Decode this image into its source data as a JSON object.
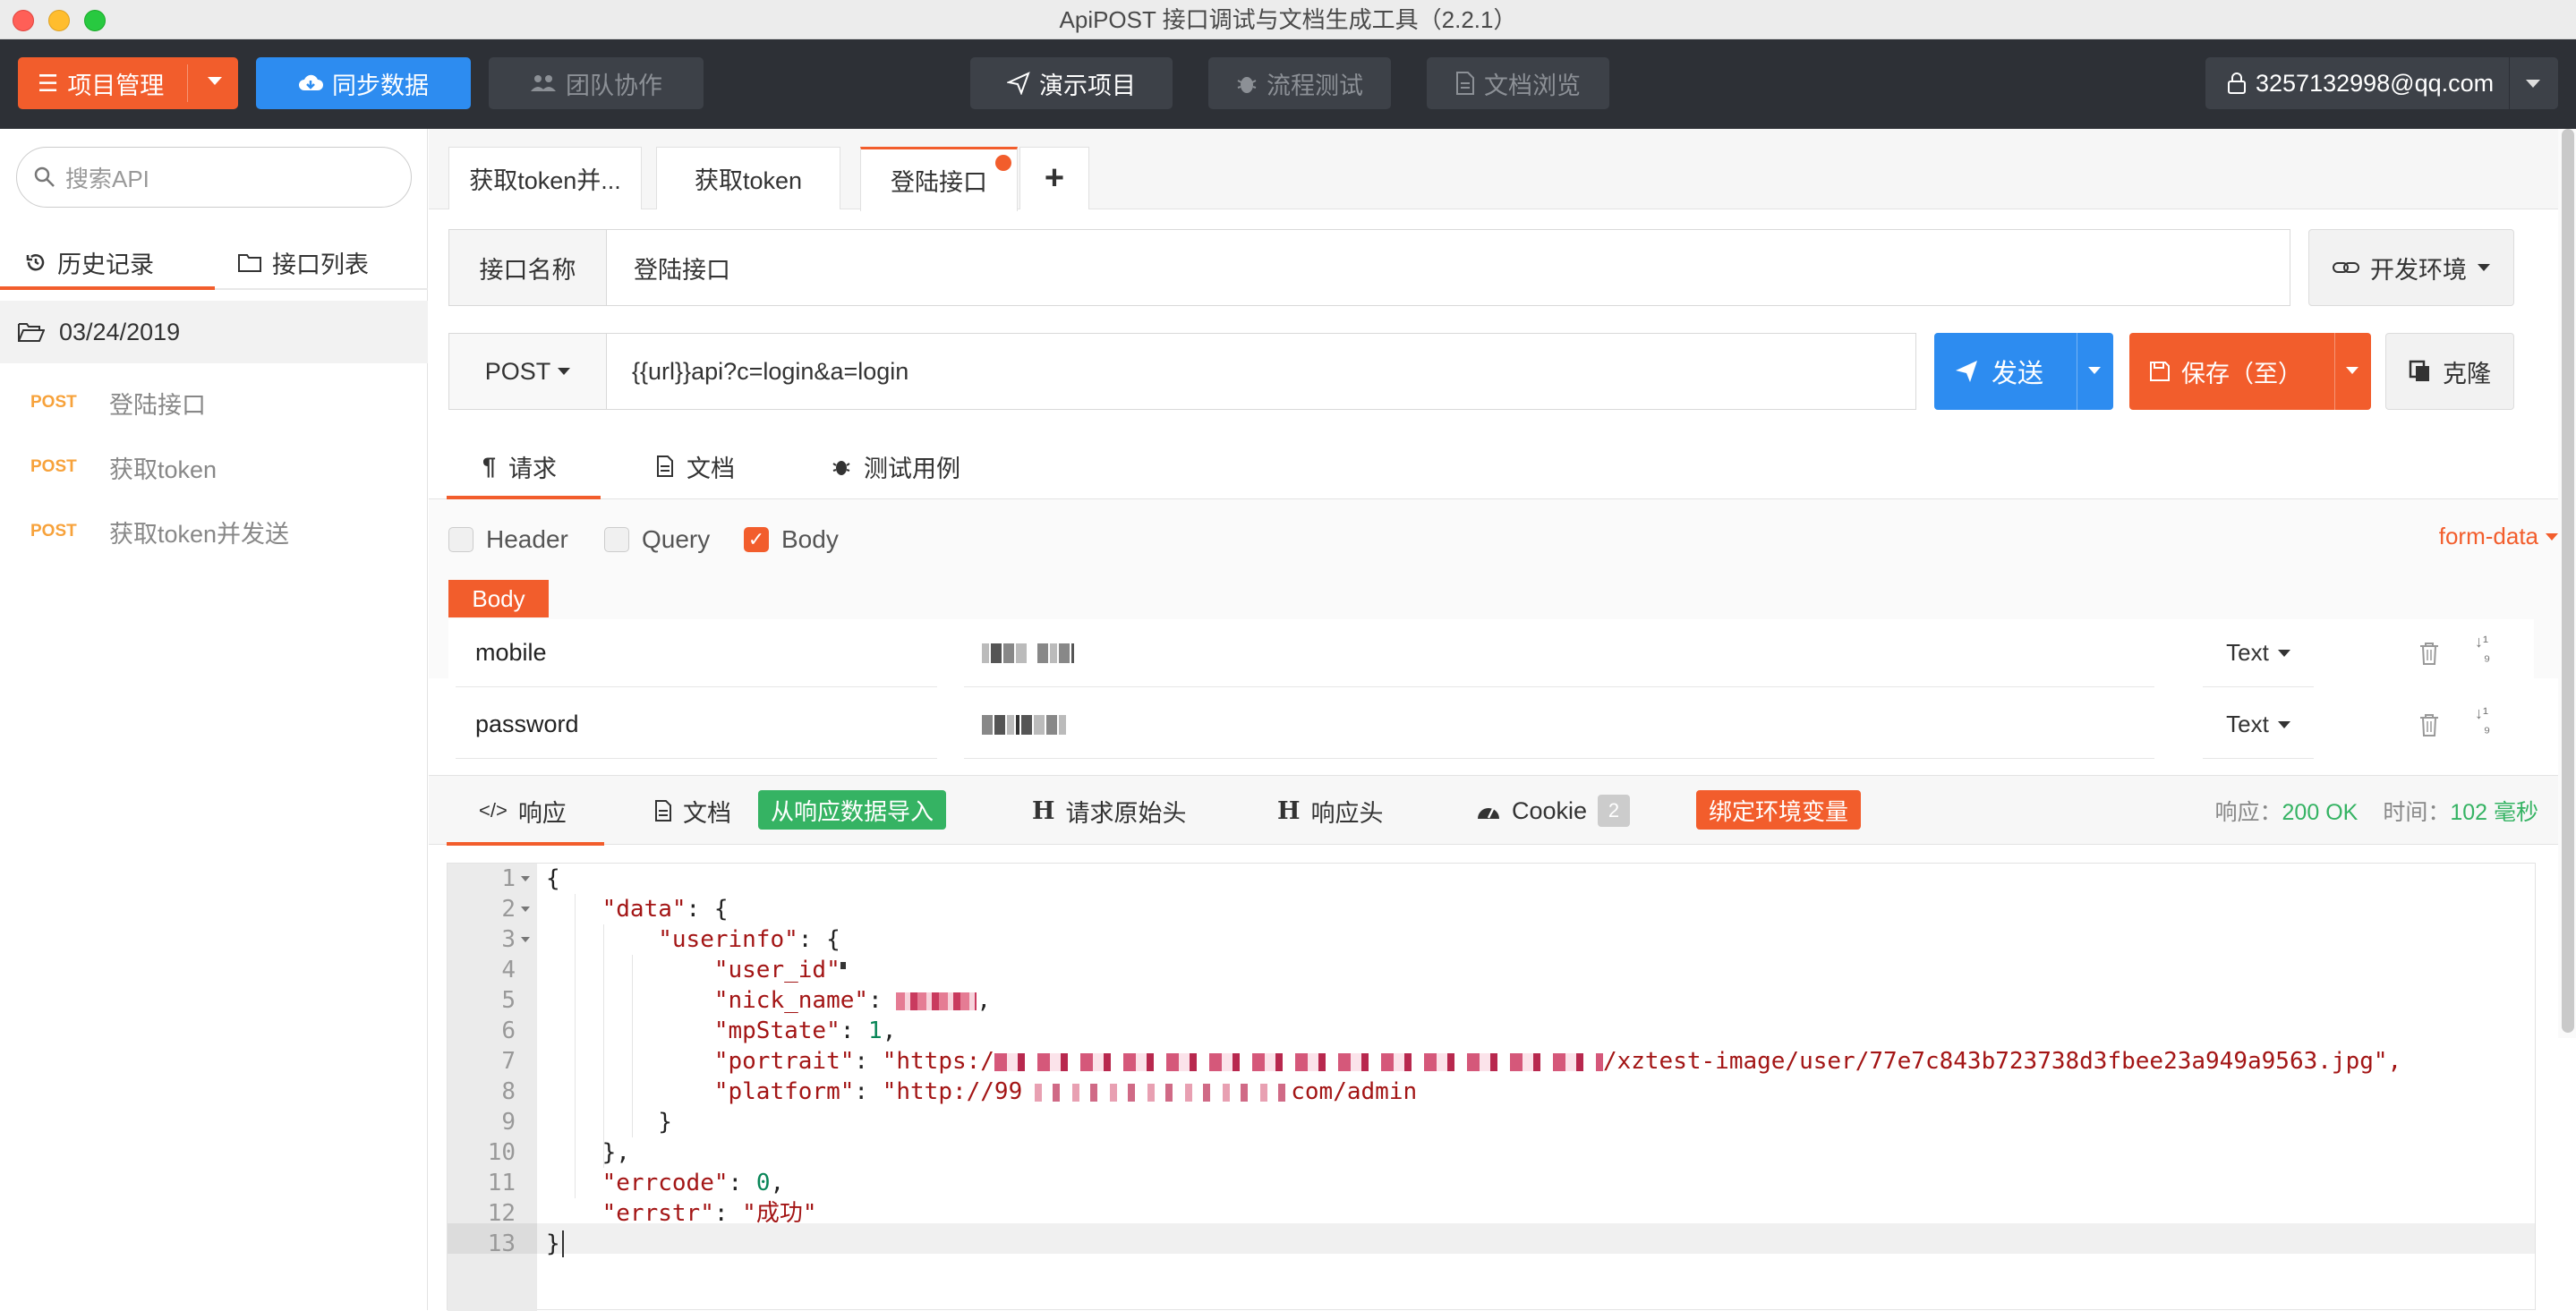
{
  "window": {
    "title": "ApiPOST 接口调试与文档生成工具（2.2.1）"
  },
  "toolbar": {
    "project_mgmt": "项目管理",
    "sync": "同步数据",
    "team": "团队协作",
    "demo": "演示项目",
    "flow": "流程测试",
    "docs": "文档浏览",
    "user": "3257132998@qq.com"
  },
  "sidebar": {
    "search_placeholder": "搜索API",
    "tab_history": "历史记录",
    "tab_list": "接口列表",
    "date_folder": "03/24/2019",
    "items": [
      {
        "method": "POST",
        "name": "登陆接口"
      },
      {
        "method": "POST",
        "name": "获取token"
      },
      {
        "method": "POST",
        "name": "获取token并发送"
      }
    ]
  },
  "tabs": [
    {
      "label": "获取token并..."
    },
    {
      "label": "获取token"
    },
    {
      "label": "登陆接口"
    }
  ],
  "request": {
    "name_label": "接口名称",
    "name_value": "登陆接口",
    "env": "开发环境",
    "method": "POST",
    "url": "{{url}}api?c=login&a=login",
    "send": "发送",
    "save": "保存（至）",
    "clone": "克隆"
  },
  "req_tabs": {
    "request": "请求",
    "docs": "文档",
    "test_cases": "测试用例"
  },
  "params": {
    "header": "Header",
    "query": "Query",
    "body": "Body",
    "body_checked": true,
    "format": "form-data",
    "body_label": "Body",
    "rows": [
      {
        "key": "mobile",
        "type": "Text"
      },
      {
        "key": "password",
        "type": "Text"
      }
    ]
  },
  "response": {
    "tab_response": "响应",
    "tab_docs": "文档",
    "import_btn": "从响应数据导入",
    "tab_raw_headers": "请求原始头",
    "tab_resp_headers": "响应头",
    "tab_cookie": "Cookie",
    "cookie_count": "2",
    "bind_env": "绑定环境变量",
    "status_label": "响应：",
    "status_value": "200 OK",
    "time_label": "时间：",
    "time_value": "102 毫秒"
  },
  "code": {
    "l1": "{",
    "l2_key": "\"data\"",
    "l2_rest": ": {",
    "l3_key": "\"userinfo\"",
    "l3_rest": ": {",
    "l4_key": "\"user_id\"",
    "l5_key": "\"nick_name\"",
    "l5_sep": ": ",
    "l5_end": ",",
    "l6_key": "\"mpState\"",
    "l6_sep": ": ",
    "l6_val": "1",
    "l6_end": ",",
    "l7_key": "\"portrait\"",
    "l7_sep": ": ",
    "l7_start": "\"https:/",
    "l7_end": "/xztest-image/user/77e7c843b723738d3fbee23a949a9563.jpg\",",
    "l8_key": "\"platform\"",
    "l8_sep": ": ",
    "l8_start": "\"http://99",
    "l8_end": "com/admin",
    "l9": "}",
    "l10": "},",
    "l11_key": "\"errcode\"",
    "l11_sep": ": ",
    "l11_val": "0",
    "l11_end": ",",
    "l12_key": "\"errstr\"",
    "l12_sep": ": ",
    "l12_val": "\"成功\"",
    "l13": "}"
  }
}
